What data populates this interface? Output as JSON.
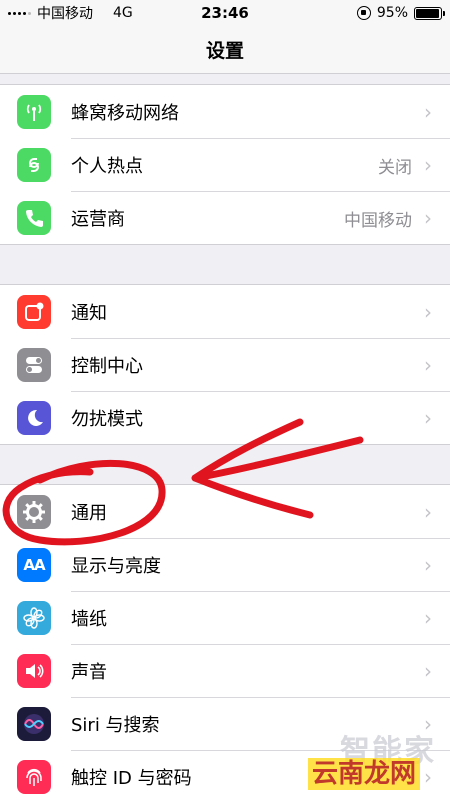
{
  "status_bar": {
    "carrier": "中国移动",
    "network": "4G",
    "time": "23:46",
    "battery": "95%",
    "battery_level": 0.95
  },
  "nav": {
    "title": "设置"
  },
  "groups": [
    {
      "items": [
        {
          "label": "蜂窝移动网络",
          "value": "",
          "icon": "antenna-icon",
          "color": "#4cd964"
        },
        {
          "label": "个人热点",
          "value": "关闭",
          "icon": "hotspot-icon",
          "color": "#4cd964"
        },
        {
          "label": "运营商",
          "value": "中国移动",
          "icon": "phone-icon",
          "color": "#4cd964"
        }
      ]
    },
    {
      "items": [
        {
          "label": "通知",
          "value": "",
          "icon": "notification-icon",
          "color": "#ff3b30"
        },
        {
          "label": "控制中心",
          "value": "",
          "icon": "toggles-icon",
          "color": "#8e8e93"
        },
        {
          "label": "勿扰模式",
          "value": "",
          "icon": "moon-icon",
          "color": "#5856d6"
        }
      ]
    },
    {
      "items": [
        {
          "label": "通用",
          "value": "",
          "icon": "gear-icon",
          "color": "#8e8e93"
        },
        {
          "label": "显示与亮度",
          "value": "",
          "icon": "text-size-icon",
          "color": "#007aff"
        },
        {
          "label": "墙纸",
          "value": "",
          "icon": "flower-icon",
          "color": "#34aadc"
        },
        {
          "label": "声音",
          "value": "",
          "icon": "speaker-icon",
          "color": "#ff2d55"
        },
        {
          "label": "Siri 与搜索",
          "value": "",
          "icon": "siri-icon",
          "color": "#1c1c3a"
        },
        {
          "label": "触控 ID 与密码",
          "value": "",
          "icon": "fingerprint-icon",
          "color": "#ff2d55"
        }
      ]
    }
  ],
  "icons": {
    "text_size": "AA"
  },
  "watermark": {
    "line1": "智能家",
    "line2": "云南龙网"
  },
  "colors": {
    "annotation_red": "#e0141e"
  }
}
